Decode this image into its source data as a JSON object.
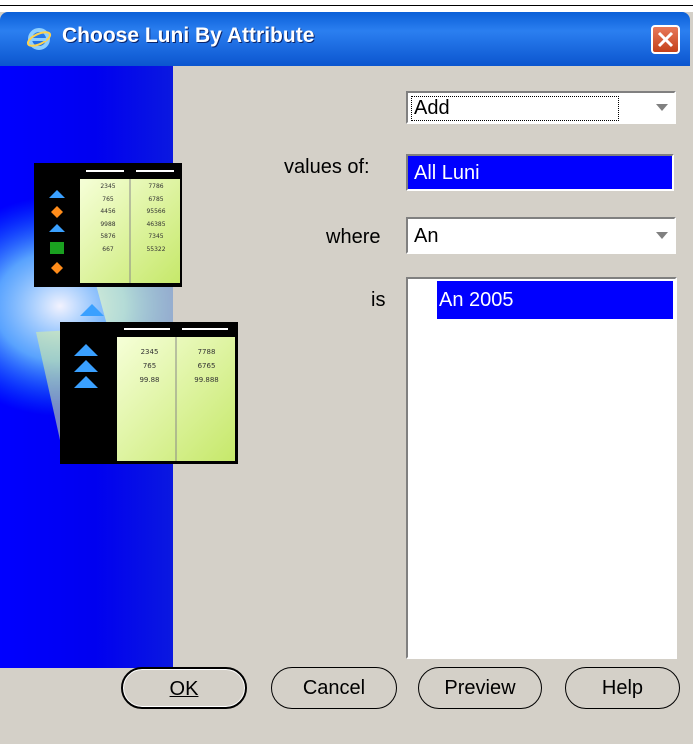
{
  "dialog": {
    "title": "Choose Luni By Attribute",
    "action": {
      "value": "Add"
    },
    "values_of": {
      "label": "values of:",
      "value": "All Luni"
    },
    "where": {
      "label": "where",
      "value": "An"
    },
    "is": {
      "label": "is",
      "items": [
        "An 2005"
      ],
      "selected_index": 0
    },
    "buttons": {
      "ok": "OK",
      "cancel": "Cancel",
      "preview": "Preview",
      "help": "Help"
    },
    "illustration": {
      "panel1": [
        [
          "2345",
          "7786"
        ],
        [
          "765",
          "6785"
        ],
        [
          "4456",
          "95566"
        ],
        [
          "9988",
          "46385"
        ],
        [
          "5876",
          "7345"
        ],
        [
          "667",
          "55322"
        ]
      ],
      "panel2": [
        [
          "2345",
          "7788"
        ],
        [
          "765",
          "6765"
        ],
        [
          "99.88",
          "99.888"
        ]
      ]
    }
  },
  "colors": {
    "title_bar": "#0a5fd8",
    "selection": "#0000ff",
    "dialog_bg": "#d4d0c8"
  }
}
